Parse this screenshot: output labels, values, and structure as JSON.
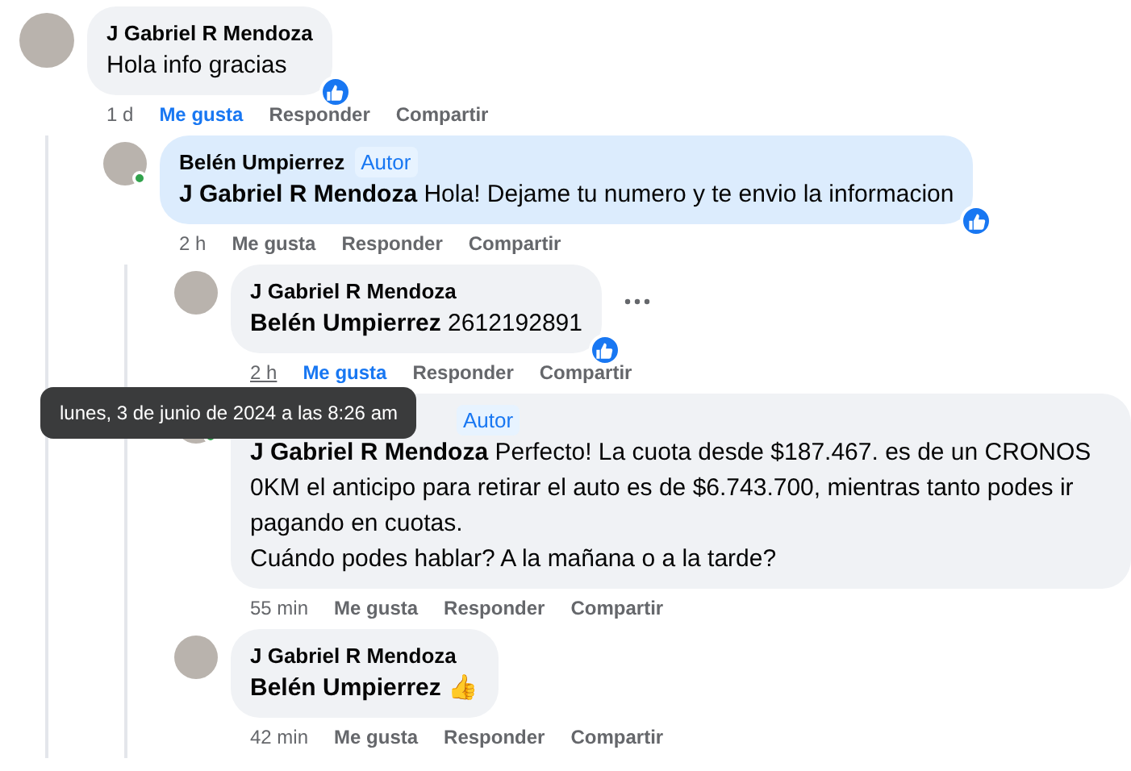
{
  "comments": [
    {
      "author": "J Gabriel R Mendoza",
      "text": "Hola info gracias",
      "highlighted": false,
      "online": false,
      "reacted": true,
      "time": "1 d",
      "time_hovered": false,
      "liked": true,
      "more_menu": false,
      "actions": [
        "Me gusta",
        "Responder",
        "Compartir"
      ],
      "children": [
        {
          "author": "Belén Umpierrez",
          "author_badge": "Autor",
          "mention": "J Gabriel R Mendoza",
          "text": "Hola! Dejame tu numero y te envio la informacion",
          "highlighted": true,
          "online": true,
          "reacted": true,
          "time": "2 h",
          "time_hovered": false,
          "liked": false,
          "more_menu": false,
          "actions": [
            "Me gusta",
            "Responder",
            "Compartir"
          ],
          "children": [
            {
              "author": "J Gabriel R Mendoza",
              "mention": "Belén Umpierrez",
              "text": "2612192891",
              "highlighted": false,
              "online": false,
              "reacted": true,
              "time": "2 h",
              "time_hovered": true,
              "liked": true,
              "more_menu": true,
              "actions": [
                "Me gusta",
                "Responder",
                "Compartir"
              ]
            },
            {
              "author_badge": "Autor",
              "mention": "J Gabriel R Mendoza",
              "text": "Perfecto! La cuota desde $187.467. es de un CRONOS 0KM el anticipo para retirar el auto es de $6.743.700, mientras tanto podes ir pagando en cuotas.\nCuándo podes hablar? A la mañana o a la tarde?",
              "highlighted": false,
              "online": true,
              "reacted": false,
              "time": "55 min",
              "time_hovered": false,
              "liked": false,
              "more_menu": false,
              "actions": [
                "Me gusta",
                "Responder",
                "Compartir"
              ]
            },
            {
              "author": "J Gabriel R Mendoza",
              "mention": "Belén Umpierrez",
              "text": "👍",
              "highlighted": false,
              "online": false,
              "reacted": false,
              "time": "42 min",
              "time_hovered": false,
              "liked": false,
              "more_menu": false,
              "actions": [
                "Me gusta",
                "Responder",
                "Compartir"
              ]
            }
          ]
        }
      ]
    }
  ],
  "tooltip": "lunes, 3 de junio de 2024 a las 8:26 am"
}
